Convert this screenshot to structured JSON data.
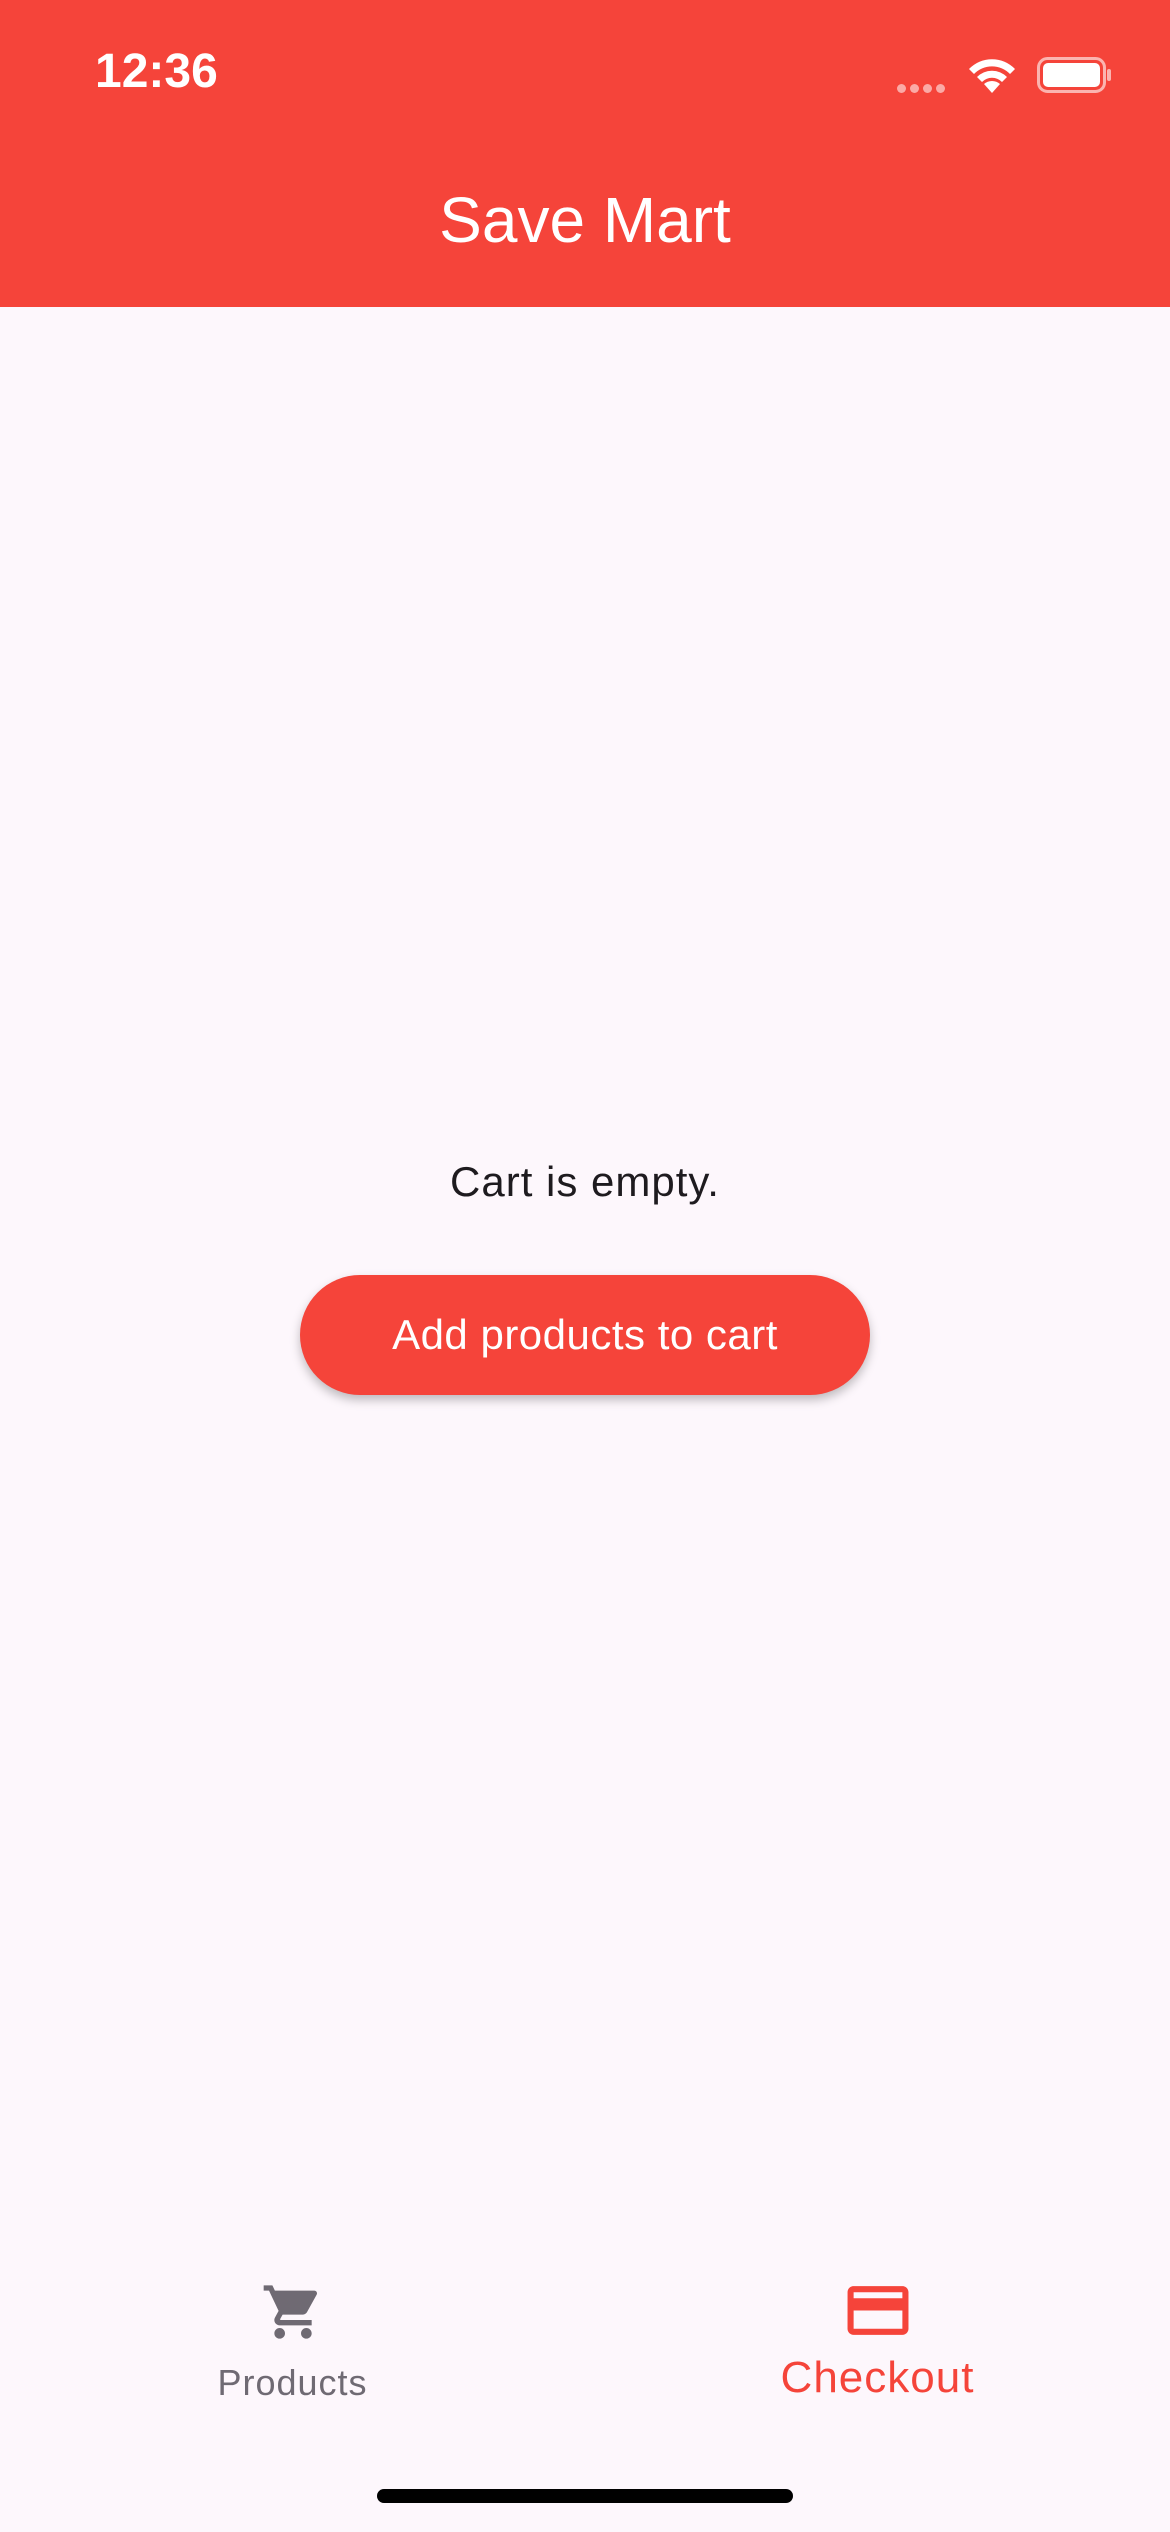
{
  "status_bar": {
    "time": "12:36"
  },
  "header": {
    "title": "Save Mart"
  },
  "cart": {
    "empty_message": "Cart is empty.",
    "add_button_label": "Add products to cart"
  },
  "bottom_nav": {
    "items": [
      {
        "label": "Products",
        "icon": "shopping-cart-icon",
        "active": false
      },
      {
        "label": "Checkout",
        "icon": "credit-card-icon",
        "active": true
      }
    ]
  },
  "colors": {
    "primary": "#F5443A",
    "background": "#FDF7FC",
    "inactive": "#6F6A73",
    "text": "#1E1B1F"
  }
}
